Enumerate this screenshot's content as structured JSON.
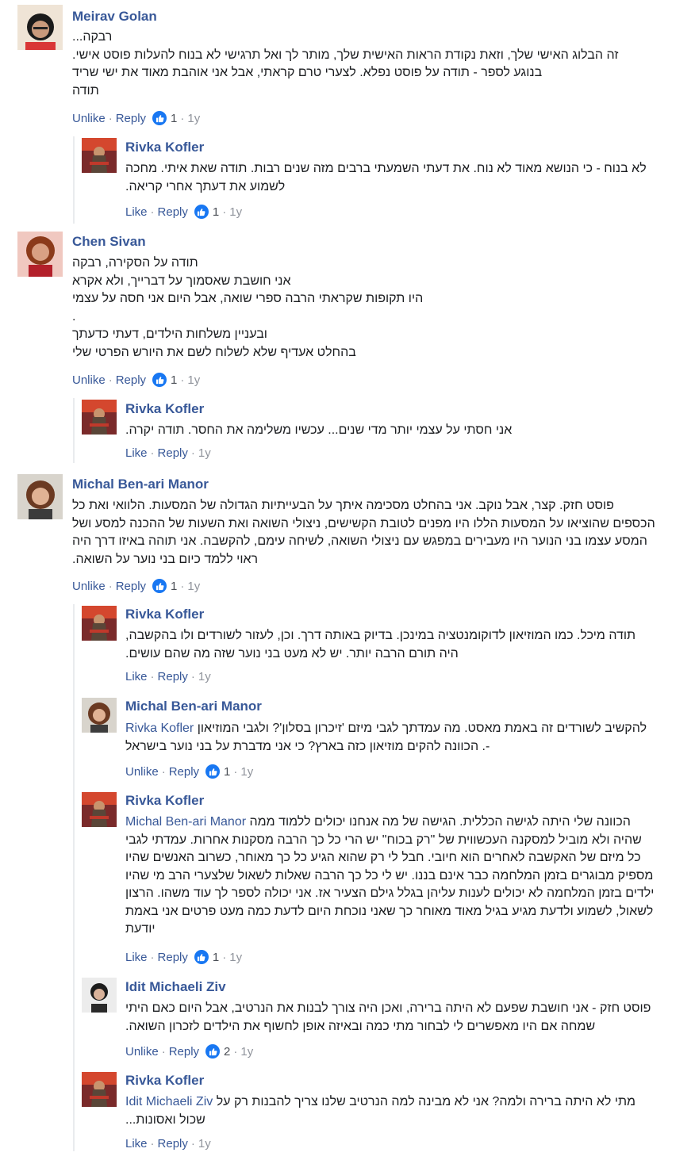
{
  "actions": {
    "like": "Like",
    "unlike": "Unlike",
    "reply": "Reply",
    "dot": "·"
  },
  "colors": {
    "link": "#385898",
    "like_blue": "#1877f2",
    "meta": "#90949c"
  },
  "comments": [
    {
      "author": "Meirav Golan",
      "lines": [
        "רבקה...",
        "זה הבלוג האישי שלך, וזאת נקודת הראות האישית שלך, מותר לך ואל תרגישי לא בנוח להעלות פוסט אישי.",
        "בנוגע לספר - תודה על פוסט נפלא. לצערי טרם קראתי, אבל אני אוהבת מאוד את ישי שריד",
        "תודה"
      ],
      "action": "Unlike",
      "likes": "1",
      "age": "1y"
    },
    {
      "author": "Rivka Kofler",
      "lines": [
        "לא בנוח - כי הנושא מאוד לא נוח. את דעתי השמעתי ברבים מזה שנים רבות. תודה שאת איתי. מחכה",
        "לשמוע את דעתך אחרי קריאה."
      ],
      "action": "Like",
      "likes": "1",
      "age": "1y"
    },
    {
      "author": "Chen Sivan",
      "lines": [
        "תודה על הסקירה, רבקה",
        "אני חושבת שאסמוך על דברייך, ולא אקרא",
        "היו תקופות שקראתי הרבה ספרי שואה, אבל היום אני חסה על עצמי",
        ".",
        "ובעניין משלחות הילדים, דעתי כדעתך",
        "בהחלט אעדיף שלא לשלוח לשם את היורש הפרטי שלי"
      ],
      "action": "Unlike",
      "likes": "1",
      "age": "1y"
    },
    {
      "author": "Rivka Kofler",
      "lines": [
        "אני חסתי על עצמי יותר מדי שנים... עכשיו משלימה את החסר. תודה יקרה."
      ],
      "action": "Like",
      "likes": "",
      "age": "1y"
    },
    {
      "author": "Michal Ben-ari Manor",
      "lines": [
        "פוסט חזק. קצר, אבל נוקב. אני בהחלט מסכימה איתך על הבעייתיות הגדולה של המסעות. הלוואי ואת כל",
        "הכספים שהוציאו על המסעות הללו היו מפנים לטובת הקשישים, ניצולי השואה ואת השעות של ההכנה למסע ושל",
        "המסע עצמו בני הנוער היו מעבירים במפגש עם ניצולי השואה, לשיחה עימם, להקשבה. אני תוהה באיזו דרך היה",
        "ראוי ללמד כיום בני נוער על השואה."
      ],
      "action": "Unlike",
      "likes": "1",
      "age": "1y"
    },
    {
      "author": "Rivka Kofler",
      "lines": [
        "תודה מיכל. כמו המוזיאון לדוקומנטציה במינכן. בדיוק באותה דרך. וכן, לעזור לשורדים ולו בהקשבה,",
        "היה תורם הרבה יותר. יש לא מעט בני נוער שזה מה שהם עושים."
      ],
      "action": "Like",
      "likes": "",
      "age": "1y"
    },
    {
      "author": "Michal Ben-ari Manor",
      "mention": "Rivka Kofler",
      "lines": [
        "להקשיב לשורדים זה באמת מאסט. מה עמדתך לגבי מיזם 'זיכרון בסלון'? ולגבי המוזיאון",
        "-. הכוונה להקים מוזיאון כזה בארץ? כי אני מדברת על בני נוער בישראל"
      ],
      "action": "Unlike",
      "likes": "1",
      "age": "1y"
    },
    {
      "author": "Rivka Kofler",
      "mention": "Michal Ben-ari Manor",
      "lines": [
        "הכוונה שלי היתה לגישה הכללית. הגישה של מה אנחנו יכולים ללמוד ממה",
        "שהיה ולא מוביל למסקנה העכשווית של \"רק בכוח\" יש הרי כל כך הרבה מסקנות אחרות. עמדתי לגבי",
        "כל מיזם של האקשבה לאחרים הוא חיובי. חבל לי רק שהוא הגיע כל כך מאוחר, כשרוב האנשים שהיו",
        "מספיק מבוגרים בזמן המלחמה כבר אינם בננו. יש לי כל כך הרבה שאלות לשאול שלצערי הרב מי שהיו",
        "ילדים בזמן המלחמה לא יכולים לענות עליהן בגלל גילם הצעיר אז. אני יכולה לספר לך עוד משהו. הרצון",
        "לשאול, לשמוע ולדעת מגיע בגיל מאוד מאוחר כך שאני נוכחת היום לדעת כמה מעט פרטים אני באמת",
        "יודעת"
      ],
      "action": "Like",
      "likes": "1",
      "age": "1y"
    },
    {
      "author": "Idit Michaeli Ziv",
      "lines": [
        "פוסט חזק - אני חושבת שפעם לא היתה ברירה, ואכן היה צורך לבנות את הנרטיב, אבל היום כאם היתי",
        "שמחה אם היו מאפשרים לי לבחור מתי כמה ובאיזה אופן לחשוף את הילדים לזכרון השואה."
      ],
      "action": "Unlike",
      "likes": "2",
      "age": "1y"
    },
    {
      "author": "Rivka Kofler",
      "mention": "Idit Michaeli Ziv",
      "lines": [
        "מתי לא היתה ברירה ולמה? אני לא מבינה למה הנרטיב שלנו צריך להבנות רק על",
        "שכול ואסונות..."
      ],
      "action": "Like",
      "likes": "",
      "age": "1y"
    }
  ]
}
